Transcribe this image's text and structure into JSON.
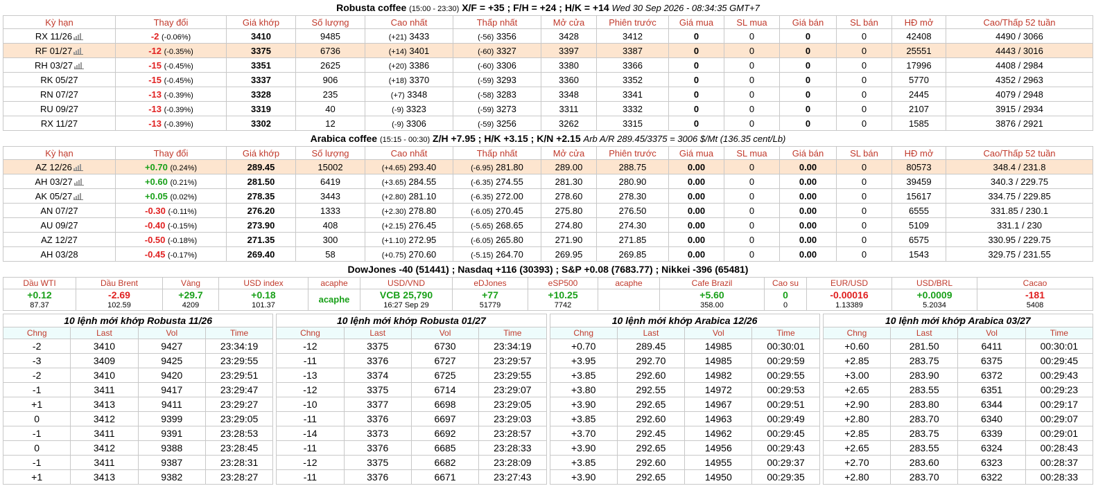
{
  "robusta": {
    "title": "Robusta coffee",
    "session": "(15:00 - 23:30)",
    "spreads": "X/F = +35 ; F/H = +24 ; H/K = +14",
    "datetime": "Wed 30 Sep 2026 - 08:34:35 GMT+7",
    "columns": [
      "Kỳ hạn",
      "Thay đổi",
      "Giá khớp",
      "Số lượng",
      "Cao nhất",
      "Thấp nhất",
      "Mở cửa",
      "Phiên trước",
      "Giá mua",
      "SL mua",
      "Giá bán",
      "SL bán",
      "HĐ mở",
      "Cao/Thấp 52 tuần"
    ],
    "rows": [
      {
        "term": "RX 11/26",
        "icon": true,
        "chg": "-2",
        "pct": "(-0.06%)",
        "dir": "neg",
        "price": "3410",
        "vol": "9485",
        "hi_d": "(+21)",
        "hi": "3433",
        "lo_d": "(-56)",
        "lo": "3356",
        "open": "3428",
        "prev": "3412",
        "bid": "0",
        "bidv": "0",
        "ask": "0",
        "askv": "0",
        "oi": "42408",
        "w52": "4490 / 3066",
        "hl": false
      },
      {
        "term": "RF 01/27",
        "icon": true,
        "chg": "-12",
        "pct": "(-0.35%)",
        "dir": "neg",
        "price": "3375",
        "vol": "6736",
        "hi_d": "(+14)",
        "hi": "3401",
        "lo_d": "(-60)",
        "lo": "3327",
        "open": "3397",
        "prev": "3387",
        "bid": "0",
        "bidv": "0",
        "ask": "0",
        "askv": "0",
        "oi": "25551",
        "w52": "4443 / 3016",
        "hl": true
      },
      {
        "term": "RH 03/27",
        "icon": true,
        "chg": "-15",
        "pct": "(-0.45%)",
        "dir": "neg",
        "price": "3351",
        "vol": "2625",
        "hi_d": "(+20)",
        "hi": "3386",
        "lo_d": "(-60)",
        "lo": "3306",
        "open": "3380",
        "prev": "3366",
        "bid": "0",
        "bidv": "0",
        "ask": "0",
        "askv": "0",
        "oi": "17996",
        "w52": "4408 / 2984",
        "hl": false
      },
      {
        "term": "RK 05/27",
        "icon": false,
        "chg": "-15",
        "pct": "(-0.45%)",
        "dir": "neg",
        "price": "3337",
        "vol": "906",
        "hi_d": "(+18)",
        "hi": "3370",
        "lo_d": "(-59)",
        "lo": "3293",
        "open": "3360",
        "prev": "3352",
        "bid": "0",
        "bidv": "0",
        "ask": "0",
        "askv": "0",
        "oi": "5770",
        "w52": "4352 / 2963",
        "hl": false
      },
      {
        "term": "RN 07/27",
        "icon": false,
        "chg": "-13",
        "pct": "(-0.39%)",
        "dir": "neg",
        "price": "3328",
        "vol": "235",
        "hi_d": "(+7)",
        "hi": "3348",
        "lo_d": "(-58)",
        "lo": "3283",
        "open": "3348",
        "prev": "3341",
        "bid": "0",
        "bidv": "0",
        "ask": "0",
        "askv": "0",
        "oi": "2445",
        "w52": "4079 / 2948",
        "hl": false
      },
      {
        "term": "RU 09/27",
        "icon": false,
        "chg": "-13",
        "pct": "(-0.39%)",
        "dir": "neg",
        "price": "3319",
        "vol": "40",
        "hi_d": "(-9)",
        "hi": "3323",
        "lo_d": "(-59)",
        "lo": "3273",
        "open": "3311",
        "prev": "3332",
        "bid": "0",
        "bidv": "0",
        "ask": "0",
        "askv": "0",
        "oi": "2107",
        "w52": "3915 / 2934",
        "hl": false
      },
      {
        "term": "RX 11/27",
        "icon": false,
        "chg": "-13",
        "pct": "(-0.39%)",
        "dir": "neg",
        "price": "3302",
        "vol": "12",
        "hi_d": "(-9)",
        "hi": "3306",
        "lo_d": "(-59)",
        "lo": "3256",
        "open": "3262",
        "prev": "3315",
        "bid": "0",
        "bidv": "0",
        "ask": "0",
        "askv": "0",
        "oi": "1585",
        "w52": "3876 / 2921",
        "hl": false
      }
    ]
  },
  "arabica": {
    "title": "Arabica coffee",
    "session": "(15:15 - 00:30)",
    "spreads": "Z/H +7.95 ; H/K +3.15 ; K/N +2.15",
    "arb": "Arb A/R 289.45/3375 = 3006 $/Mt (136.35 cent/Lb)",
    "rows": [
      {
        "term": "AZ 12/26",
        "icon": true,
        "chg": "+0.70",
        "pct": "(0.24%)",
        "dir": "pos",
        "price": "289.45",
        "vol": "15002",
        "hi_d": "(+4.65)",
        "hi": "293.40",
        "lo_d": "(-6.95)",
        "lo": "281.80",
        "open": "289.00",
        "prev": "288.75",
        "bid": "0.00",
        "bidv": "0",
        "ask": "0.00",
        "askv": "0",
        "oi": "80573",
        "w52": "348.4 / 231.8",
        "hl": true
      },
      {
        "term": "AH 03/27",
        "icon": true,
        "chg": "+0.60",
        "pct": "(0.21%)",
        "dir": "pos",
        "price": "281.50",
        "vol": "6419",
        "hi_d": "(+3.65)",
        "hi": "284.55",
        "lo_d": "(-6.35)",
        "lo": "274.55",
        "open": "281.30",
        "prev": "280.90",
        "bid": "0.00",
        "bidv": "0",
        "ask": "0.00",
        "askv": "0",
        "oi": "39459",
        "w52": "340.3 / 229.75",
        "hl": false
      },
      {
        "term": "AK 05/27",
        "icon": true,
        "chg": "+0.05",
        "pct": "(0.02%)",
        "dir": "pos",
        "price": "278.35",
        "vol": "3443",
        "hi_d": "(+2.80)",
        "hi": "281.10",
        "lo_d": "(-6.35)",
        "lo": "272.00",
        "open": "278.60",
        "prev": "278.30",
        "bid": "0.00",
        "bidv": "0",
        "ask": "0.00",
        "askv": "0",
        "oi": "15617",
        "w52": "334.75 / 229.85",
        "hl": false
      },
      {
        "term": "AN 07/27",
        "icon": false,
        "chg": "-0.30",
        "pct": "(-0.11%)",
        "dir": "neg",
        "price": "276.20",
        "vol": "1333",
        "hi_d": "(+2.30)",
        "hi": "278.80",
        "lo_d": "(-6.05)",
        "lo": "270.45",
        "open": "275.80",
        "prev": "276.50",
        "bid": "0.00",
        "bidv": "0",
        "ask": "0.00",
        "askv": "0",
        "oi": "6555",
        "w52": "331.85 / 230.1",
        "hl": false
      },
      {
        "term": "AU 09/27",
        "icon": false,
        "chg": "-0.40",
        "pct": "(-0.15%)",
        "dir": "neg",
        "price": "273.90",
        "vol": "408",
        "hi_d": "(+2.15)",
        "hi": "276.45",
        "lo_d": "(-5.65)",
        "lo": "268.65",
        "open": "274.80",
        "prev": "274.30",
        "bid": "0.00",
        "bidv": "0",
        "ask": "0.00",
        "askv": "0",
        "oi": "5109",
        "w52": "331.1 / 230",
        "hl": false
      },
      {
        "term": "AZ 12/27",
        "icon": false,
        "chg": "-0.50",
        "pct": "(-0.18%)",
        "dir": "neg",
        "price": "271.35",
        "vol": "300",
        "hi_d": "(+1.10)",
        "hi": "272.95",
        "lo_d": "(-6.05)",
        "lo": "265.80",
        "open": "271.90",
        "prev": "271.85",
        "bid": "0.00",
        "bidv": "0",
        "ask": "0.00",
        "askv": "0",
        "oi": "6575",
        "w52": "330.95 / 229.75",
        "hl": false
      },
      {
        "term": "AH 03/28",
        "icon": false,
        "chg": "-0.45",
        "pct": "(-0.17%)",
        "dir": "neg",
        "price": "269.40",
        "vol": "58",
        "hi_d": "(+0.75)",
        "hi": "270.60",
        "lo_d": "(-5.15)",
        "lo": "264.70",
        "open": "269.95",
        "prev": "269.85",
        "bid": "0.00",
        "bidv": "0",
        "ask": "0.00",
        "askv": "0",
        "oi": "1543",
        "w52": "329.75 / 231.55",
        "hl": false
      }
    ]
  },
  "indices_line": "DowJones -40 (51441) ; Nasdaq +116 (30393) ; S&P +0.08 (7683.77) ; Nikkei -396 (65481)",
  "indices": [
    {
      "label": "Dầu WTI",
      "val": "+0.12",
      "dir": "pos",
      "sub": "87.37"
    },
    {
      "label": "Dầu Brent",
      "val": "-2.69",
      "dir": "neg",
      "sub": "102.59"
    },
    {
      "label": "Vàng",
      "val": "+29.7",
      "dir": "pos",
      "sub": "4209"
    },
    {
      "label": "USD index",
      "val": "+0.18",
      "dir": "pos",
      "sub": "101.37"
    },
    {
      "label": "acaphe",
      "val": "acaphe",
      "dir": "pos",
      "sub": ""
    },
    {
      "label": "USD/VND",
      "val": "VCB 25,790",
      "dir": "pos",
      "sub": "16:27 Sep 29"
    },
    {
      "label": "eDJones",
      "val": "+77",
      "dir": "pos",
      "sub": "51779"
    },
    {
      "label": "eSP500",
      "val": "+10.25",
      "dir": "pos",
      "sub": "7742"
    },
    {
      "label": "acaphe",
      "val": "",
      "dir": "pos",
      "sub": ""
    },
    {
      "label": "Cafe Brazil",
      "val": "+5.60",
      "dir": "pos",
      "sub": "358.00"
    },
    {
      "label": "Cao su",
      "val": "0",
      "dir": "pos",
      "sub": "0"
    },
    {
      "label": "EUR/USD",
      "val": "-0.00016",
      "dir": "neg",
      "sub": "1.13389"
    },
    {
      "label": "USD/BRL",
      "val": "+0.0009",
      "dir": "pos",
      "sub": "5.2034"
    },
    {
      "label": "Cacao",
      "val": "-181",
      "dir": "neg",
      "sub": "5408"
    }
  ],
  "trades_columns": [
    "Chng",
    "Last",
    "Vol",
    "Time"
  ],
  "trades": [
    {
      "title": "10 lệnh mới khớp Robusta 11/26",
      "rows": [
        [
          "-2",
          "3410",
          "9427",
          "23:34:19"
        ],
        [
          "-3",
          "3409",
          "9425",
          "23:29:55"
        ],
        [
          "-2",
          "3410",
          "9420",
          "23:29:51"
        ],
        [
          "-1",
          "3411",
          "9417",
          "23:29:47"
        ],
        [
          "+1",
          "3413",
          "9411",
          "23:29:27"
        ],
        [
          "0",
          "3412",
          "9399",
          "23:29:05"
        ],
        [
          "-1",
          "3411",
          "9391",
          "23:28:53"
        ],
        [
          "0",
          "3412",
          "9388",
          "23:28:45"
        ],
        [
          "-1",
          "3411",
          "9387",
          "23:28:31"
        ],
        [
          "+1",
          "3413",
          "9382",
          "23:28:27"
        ]
      ]
    },
    {
      "title": "10 lệnh mới khớp Robusta 01/27",
      "rows": [
        [
          "-12",
          "3375",
          "6730",
          "23:34:19"
        ],
        [
          "-11",
          "3376",
          "6727",
          "23:29:57"
        ],
        [
          "-13",
          "3374",
          "6725",
          "23:29:55"
        ],
        [
          "-12",
          "3375",
          "6714",
          "23:29:07"
        ],
        [
          "-10",
          "3377",
          "6698",
          "23:29:05"
        ],
        [
          "-11",
          "3376",
          "6697",
          "23:29:03"
        ],
        [
          "-14",
          "3373",
          "6692",
          "23:28:57"
        ],
        [
          "-11",
          "3376",
          "6685",
          "23:28:33"
        ],
        [
          "-12",
          "3375",
          "6682",
          "23:28:09"
        ],
        [
          "-11",
          "3376",
          "6671",
          "23:27:43"
        ]
      ]
    },
    {
      "title": "10 lệnh mới khớp Arabica 12/26",
      "rows": [
        [
          "+0.70",
          "289.45",
          "14985",
          "00:30:01"
        ],
        [
          "+3.95",
          "292.70",
          "14985",
          "00:29:59"
        ],
        [
          "+3.85",
          "292.60",
          "14982",
          "00:29:55"
        ],
        [
          "+3.80",
          "292.55",
          "14972",
          "00:29:53"
        ],
        [
          "+3.90",
          "292.65",
          "14967",
          "00:29:51"
        ],
        [
          "+3.85",
          "292.60",
          "14963",
          "00:29:49"
        ],
        [
          "+3.70",
          "292.45",
          "14962",
          "00:29:45"
        ],
        [
          "+3.90",
          "292.65",
          "14956",
          "00:29:43"
        ],
        [
          "+3.85",
          "292.60",
          "14955",
          "00:29:37"
        ],
        [
          "+3.90",
          "292.65",
          "14950",
          "00:29:35"
        ]
      ]
    },
    {
      "title": "10 lệnh mới khớp Arabica 03/27",
      "rows": [
        [
          "+0.60",
          "281.50",
          "6411",
          "00:30:01"
        ],
        [
          "+2.85",
          "283.75",
          "6375",
          "00:29:45"
        ],
        [
          "+3.00",
          "283.90",
          "6372",
          "00:29:43"
        ],
        [
          "+2.65",
          "283.55",
          "6351",
          "00:29:23"
        ],
        [
          "+2.90",
          "283.80",
          "6344",
          "00:29:17"
        ],
        [
          "+2.80",
          "283.70",
          "6340",
          "00:29:07"
        ],
        [
          "+2.85",
          "283.75",
          "6339",
          "00:29:01"
        ],
        [
          "+2.65",
          "283.55",
          "6324",
          "00:28:43"
        ],
        [
          "+2.70",
          "283.60",
          "6323",
          "00:28:37"
        ],
        [
          "+2.80",
          "283.70",
          "6322",
          "00:28:33"
        ]
      ]
    }
  ],
  "colors": {
    "up": "#19a019",
    "down": "#e02020",
    "header_text": "#c0392b",
    "highlight": "#fde5cf",
    "subhead_bg": "#eefcfc"
  },
  "icons": {
    "chart": "bar-chart-icon"
  }
}
